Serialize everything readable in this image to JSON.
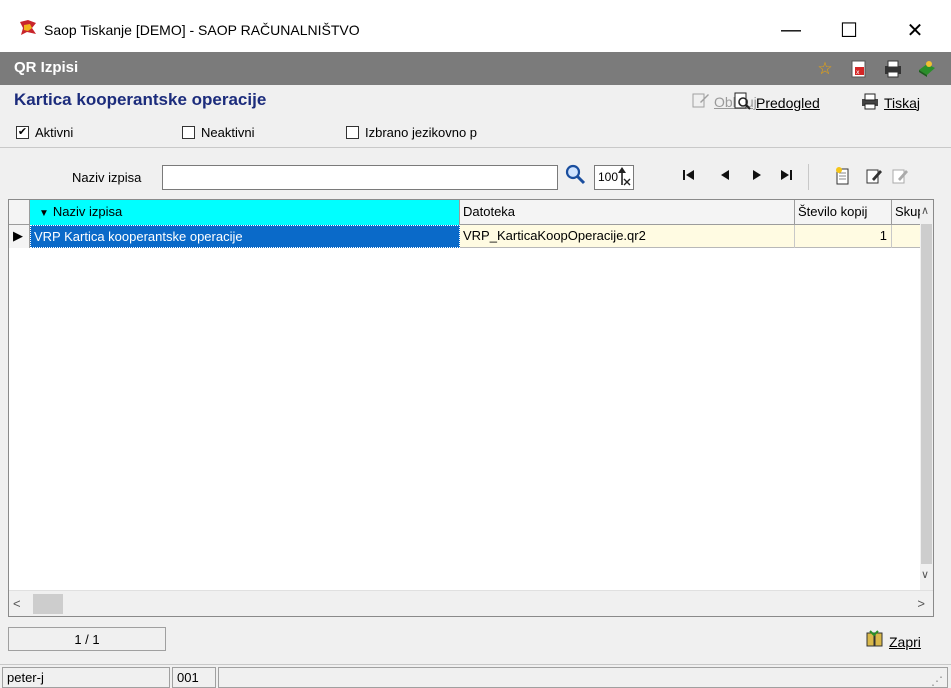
{
  "window": {
    "title": "Saop Tiskanje [DEMO] - SAOP RAČUNALNIŠTVO",
    "min_glyph": "—",
    "max_glyph": "☐",
    "close_glyph": "✕"
  },
  "qrbar": {
    "title": "QR Izpisi"
  },
  "header": {
    "title": "Kartica kooperantske operacije",
    "actions": {
      "oblikuj": "Oblikuj",
      "predogled": "Predogled",
      "tiskaj": "Tiskaj"
    }
  },
  "filters": {
    "aktivni": {
      "label": "Aktivni",
      "checked": true
    },
    "neaktivni": {
      "label": "Neaktivni",
      "checked": false
    },
    "jezikovno": {
      "label": "Izbrano jezikovno p",
      "checked": false
    }
  },
  "search": {
    "label": "Naziv izpisa",
    "value": "",
    "limit": "100"
  },
  "grid": {
    "columns": [
      "Naziv izpisa",
      "Datoteka",
      "Število kopij",
      "Skupr"
    ],
    "rows": [
      {
        "indicator": "▶",
        "naziv": "VRP Kartica kooperantske operacije",
        "datoteka": "VRP_KarticaKoopOperacije.qr2",
        "kopij": "1",
        "skupina": ""
      }
    ]
  },
  "footer": {
    "page_counter": "1 / 1",
    "close_label": "Zapri"
  },
  "statusbar": {
    "user": "peter-j",
    "code": "001",
    "message": ""
  },
  "colors": {
    "title_blue": "#1c2c7c",
    "qrbar_gray": "#7b7b7b",
    "header_highlight": "#00ffff",
    "selection_blue": "#0a6ac9",
    "row_bg": "#fffbe2"
  }
}
